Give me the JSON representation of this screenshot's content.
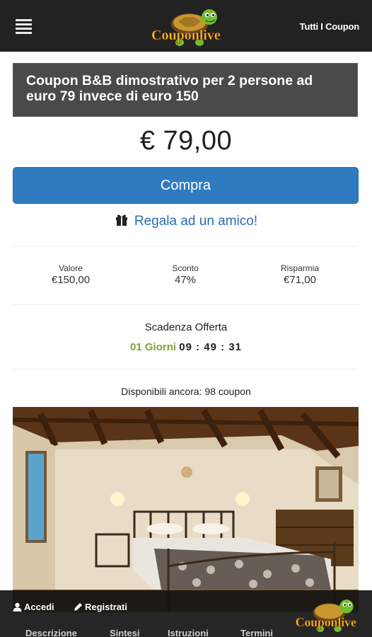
{
  "header": {
    "menu_icon": "hamburger-icon",
    "logo_text": "Couponlive",
    "right_link": "Tutti I Coupon"
  },
  "offer": {
    "title": "Coupon B&B dimostrativo per 2 persone ad euro 79 invece di euro 150",
    "price": "€ 79,00",
    "buy_label": "Compra",
    "gift_label": "Regala ad un amico!",
    "gift_icon": "gift-icon"
  },
  "stats": [
    {
      "label": "Valore",
      "value": "€150,00"
    },
    {
      "label": "Sconto",
      "value": "47%"
    },
    {
      "label": "Risparmia",
      "value": "€71,00"
    }
  ],
  "expiry": {
    "title": "Scadenza Offerta",
    "days": "01 Giorni",
    "time": "09 : 49 : 31"
  },
  "availability": "Disponibili ancora: 98 coupon",
  "bottom": {
    "login": "Accedi",
    "register": "Registrati",
    "tabs": [
      "Descrizione",
      "Sintesi",
      "Istruzioni",
      "Termini"
    ]
  },
  "colors": {
    "topbar": "#222222",
    "title_bg": "#4a4a4a",
    "accent_blue": "#2f7bbf",
    "link_blue": "#2a6db5",
    "days_green": "#7aa33a"
  }
}
